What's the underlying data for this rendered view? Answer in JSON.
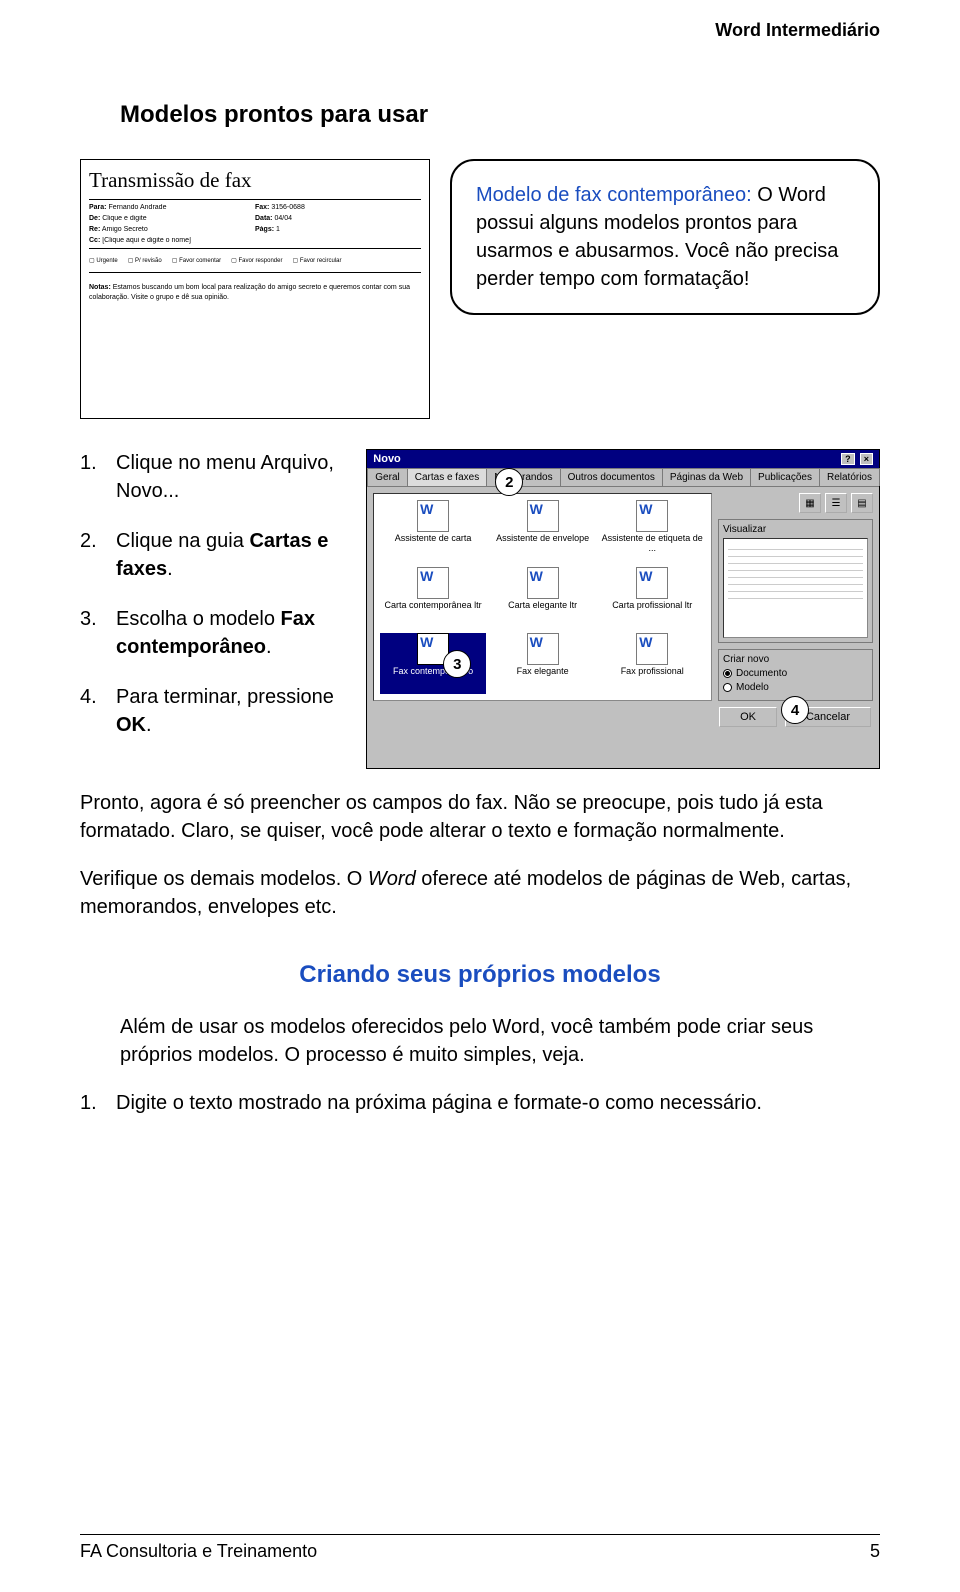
{
  "header": {
    "doc_title": "Word Intermediário"
  },
  "section1": {
    "title": "Modelos prontos para usar",
    "callout_emph": "Modelo de fax contemporâneo:",
    "callout_rest": " O Word possui alguns modelos prontos para usarmos e abusarmos. Você não precisa perder tempo com formatação!"
  },
  "fax_preview": {
    "title": "Transmissão de fax",
    "fields": {
      "para_lbl": "Para:",
      "para_val": "Fernando Andrade",
      "fax_lbl": "Fax:",
      "fax_val": "3156-0688",
      "de_lbl": "De:",
      "de_val": "Clique e digite",
      "data_lbl": "Data:",
      "data_val": "04/04",
      "re_lbl": "Re:",
      "re_val": "Amigo Secreto",
      "pag_lbl": "Págs:",
      "pag_val": "1",
      "cc_lbl": "Cc:",
      "cc_val": "[Clique aqui e digite o nome]"
    },
    "checks": [
      "Urgente",
      "P/ revisão",
      "Favor comentar",
      "Favor responder",
      "Favor recircular"
    ],
    "note_lbl": "Notas:",
    "note": "Estamos buscando um bom local para realização do amigo secreto e queremos contar com sua colaboração. Visite o grupo e dê sua opinião."
  },
  "steps": [
    {
      "num": "1.",
      "text": "Clique no menu Arquivo, Novo..."
    },
    {
      "num": "2.",
      "text_pre": "Clique na guia ",
      "bold": "Cartas e faxes",
      "text_post": "."
    },
    {
      "num": "3.",
      "text_pre": "Escolha o modelo ",
      "bold": "Fax contemporâneo",
      "text_post": "."
    },
    {
      "num": "4.",
      "text_pre": "Para terminar, pressione ",
      "bold": "OK",
      "text_post": "."
    }
  ],
  "dialog": {
    "title": "Novo",
    "tabs": [
      "Geral",
      "Cartas e faxes",
      "Memorandos",
      "Outros documentos",
      "Páginas da Web",
      "Publicações",
      "Relatórios"
    ],
    "templates": [
      "Assistente de carta",
      "Assistente de envelope",
      "Assistente de etiqueta de ...",
      "Carta contemporânea ltr",
      "Carta elegante ltr",
      "Carta profissional ltr",
      "Fax contemporâneo",
      "Fax elegante",
      "Fax profissional"
    ],
    "right": {
      "visualizar": "Visualizar",
      "criar": "Criar novo",
      "doc": "Documento",
      "modelo": "Modelo"
    },
    "ok": "OK",
    "cancel": "Cancelar"
  },
  "badges": {
    "b2": "2",
    "b3": "3",
    "b4": "4"
  },
  "para_after": "Pronto, agora é só preencher os campos do fax. Não se preocupe, pois tudo já esta formatado. Claro, se quiser, você pode alterar o texto e formação normalmente.",
  "para_verify_pre": "Verifique os demais modelos. O ",
  "para_verify_italic": "Word",
  "para_verify_post": " oferece até modelos de páginas de Web, cartas, memorandos, envelopes etc.",
  "section2": {
    "title": "Criando seus próprios modelos",
    "para": "Além de usar os modelos oferecidos pelo Word, você também pode criar seus próprios modelos. O processo é muito simples, veja.",
    "step1_num": "1.",
    "step1": "Digite o texto mostrado na próxima página e formate-o como necessário."
  },
  "footer": {
    "left": "FA Consultoria e Treinamento",
    "right": "5"
  }
}
